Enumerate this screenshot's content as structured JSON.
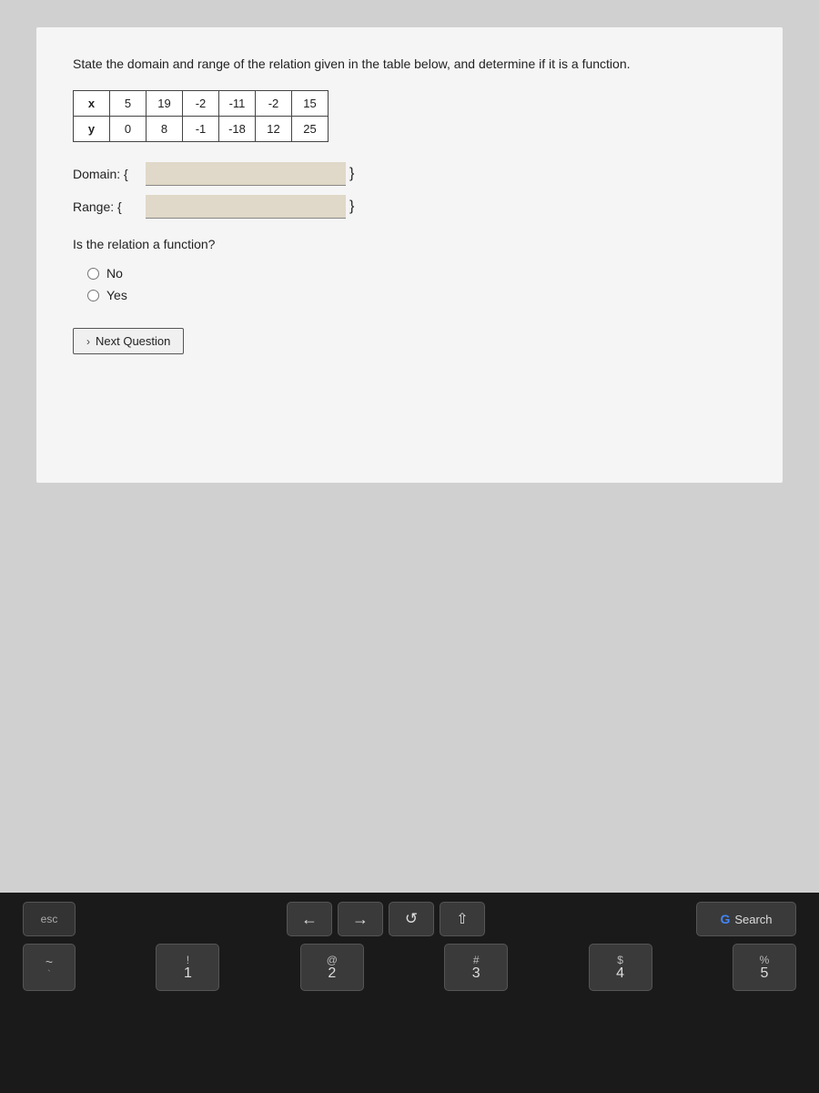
{
  "question": {
    "text": "State the domain and range of the relation given in the table below, and determine if it is a function.",
    "table": {
      "row_x_label": "x",
      "row_y_label": "y",
      "x_values": [
        "5",
        "19",
        "-2",
        "-11",
        "-2",
        "15"
      ],
      "y_values": [
        "0",
        "8",
        "-1",
        "-18",
        "12",
        "25"
      ]
    },
    "domain_label": "Domain: {",
    "domain_brace": "}",
    "range_label": "Range: {",
    "range_brace": "}",
    "function_question": "Is the relation a function?",
    "option_no": "No",
    "option_yes": "Yes",
    "next_button": "Next Question"
  },
  "keyboard": {
    "esc_label": "esc",
    "back_arrow": "←",
    "forward_arrow": "→",
    "reload": "↺",
    "home": "⇧",
    "search_label": "Search",
    "keys": [
      {
        "symbol": "~",
        "number": "`"
      },
      {
        "symbol": "!",
        "number": "1"
      },
      {
        "symbol": "@",
        "number": "2"
      },
      {
        "symbol": "#",
        "number": "3"
      },
      {
        "symbol": "$",
        "number": "4"
      },
      {
        "symbol": "%",
        "number": "5"
      }
    ]
  }
}
